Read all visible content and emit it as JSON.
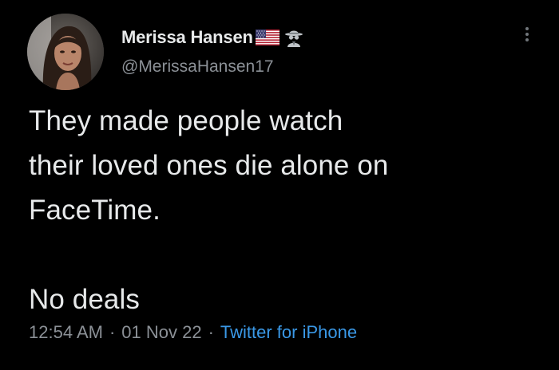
{
  "user": {
    "display_name": "Merissa Hansen",
    "handle": "@MerissaHansen17",
    "badges": [
      "us-flag-icon",
      "spy-icon"
    ]
  },
  "tweet": {
    "lines": [
      "They made people watch",
      "their loved ones die alone on",
      "FaceTime.",
      "No deals"
    ],
    "time": "12:54 AM",
    "separator": "·",
    "date": "01 Nov 22",
    "source": "Twitter for iPhone"
  },
  "colors": {
    "background": "#000000",
    "text": "#e7e9ea",
    "muted": "#8b9096",
    "link": "#3a98e6"
  },
  "icons": {
    "more": "more-options-icon"
  }
}
